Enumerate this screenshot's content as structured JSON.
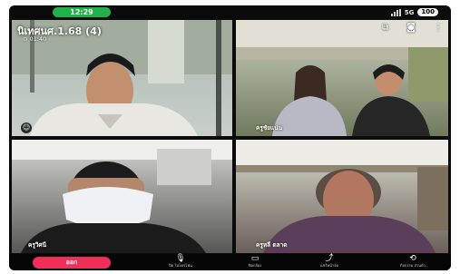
{
  "status_bar": {
    "time": "12:29",
    "network": "5G",
    "battery": "100"
  },
  "call": {
    "title": "นิเทศนศ.1.68 (4)",
    "timer": "01:40"
  },
  "participants": [
    {
      "name": ""
    },
    {
      "name": "ครูชัยแน่น"
    },
    {
      "name": "ครูวิศนี"
    },
    {
      "name": "ครูหลี ตลาด"
    }
  ],
  "controls": {
    "leave": "ออก",
    "mic": "ปิด\nไมโครโฟน",
    "video": "ปิดกล้อง",
    "share": "แชร์หน้าจอ",
    "flip": "กิจกรรม\nส่วนตัว"
  },
  "icons": {
    "mic": "microphone-icon",
    "video": "camera-icon",
    "share": "share-screen-icon",
    "flip": "switch-camera-icon",
    "emoji": "emoji-icon",
    "pip": "picture-in-picture-icon",
    "cam": "camera-switch-icon",
    "more": "more-icon"
  },
  "colors": {
    "leave": "#ef2f57",
    "time_pill": "#21b14b"
  }
}
